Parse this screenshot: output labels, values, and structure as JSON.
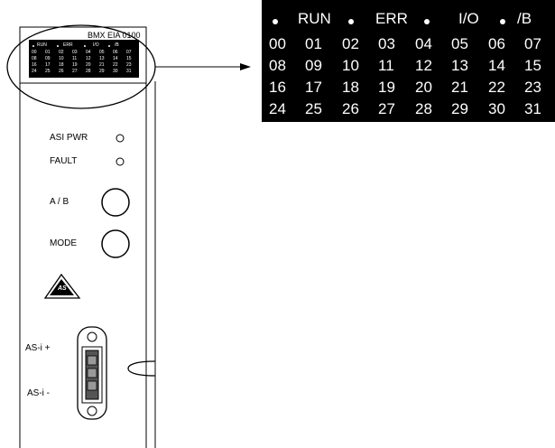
{
  "module": {
    "model_label": "BMX EIA 0100",
    "labels": {
      "asi_pwr": "ASI PWR",
      "fault": "FAULT",
      "ab": "A / B",
      "mode": "MODE",
      "asi_plus": "AS-i +",
      "asi_minus": "AS-i -"
    }
  },
  "display": {
    "status_labels": [
      "RUN",
      "ERR",
      "I/O",
      "/B"
    ],
    "rows": [
      [
        "00",
        "01",
        "02",
        "03",
        "04",
        "05",
        "06",
        "07"
      ],
      [
        "08",
        "09",
        "10",
        "11",
        "12",
        "13",
        "14",
        "15"
      ],
      [
        "16",
        "17",
        "18",
        "19",
        "20",
        "21",
        "22",
        "23"
      ],
      [
        "24",
        "25",
        "26",
        "27",
        "28",
        "29",
        "30",
        "31"
      ]
    ]
  },
  "mini_display": {
    "status_labels": [
      "RUN",
      "ERR",
      "I/O",
      "/B"
    ],
    "rows": [
      [
        "00",
        "01",
        "02",
        "03",
        "04",
        "05",
        "06",
        "07"
      ],
      [
        "08",
        "09",
        "10",
        "11",
        "12",
        "13",
        "14",
        "15"
      ],
      [
        "16",
        "17",
        "18",
        "19",
        "20",
        "21",
        "22",
        "23"
      ],
      [
        "24",
        "25",
        "26",
        "27",
        "28",
        "29",
        "30",
        "31"
      ]
    ]
  },
  "colors": {
    "panel": "#000000",
    "text_on_panel": "#ffffff",
    "line": "#000000"
  }
}
